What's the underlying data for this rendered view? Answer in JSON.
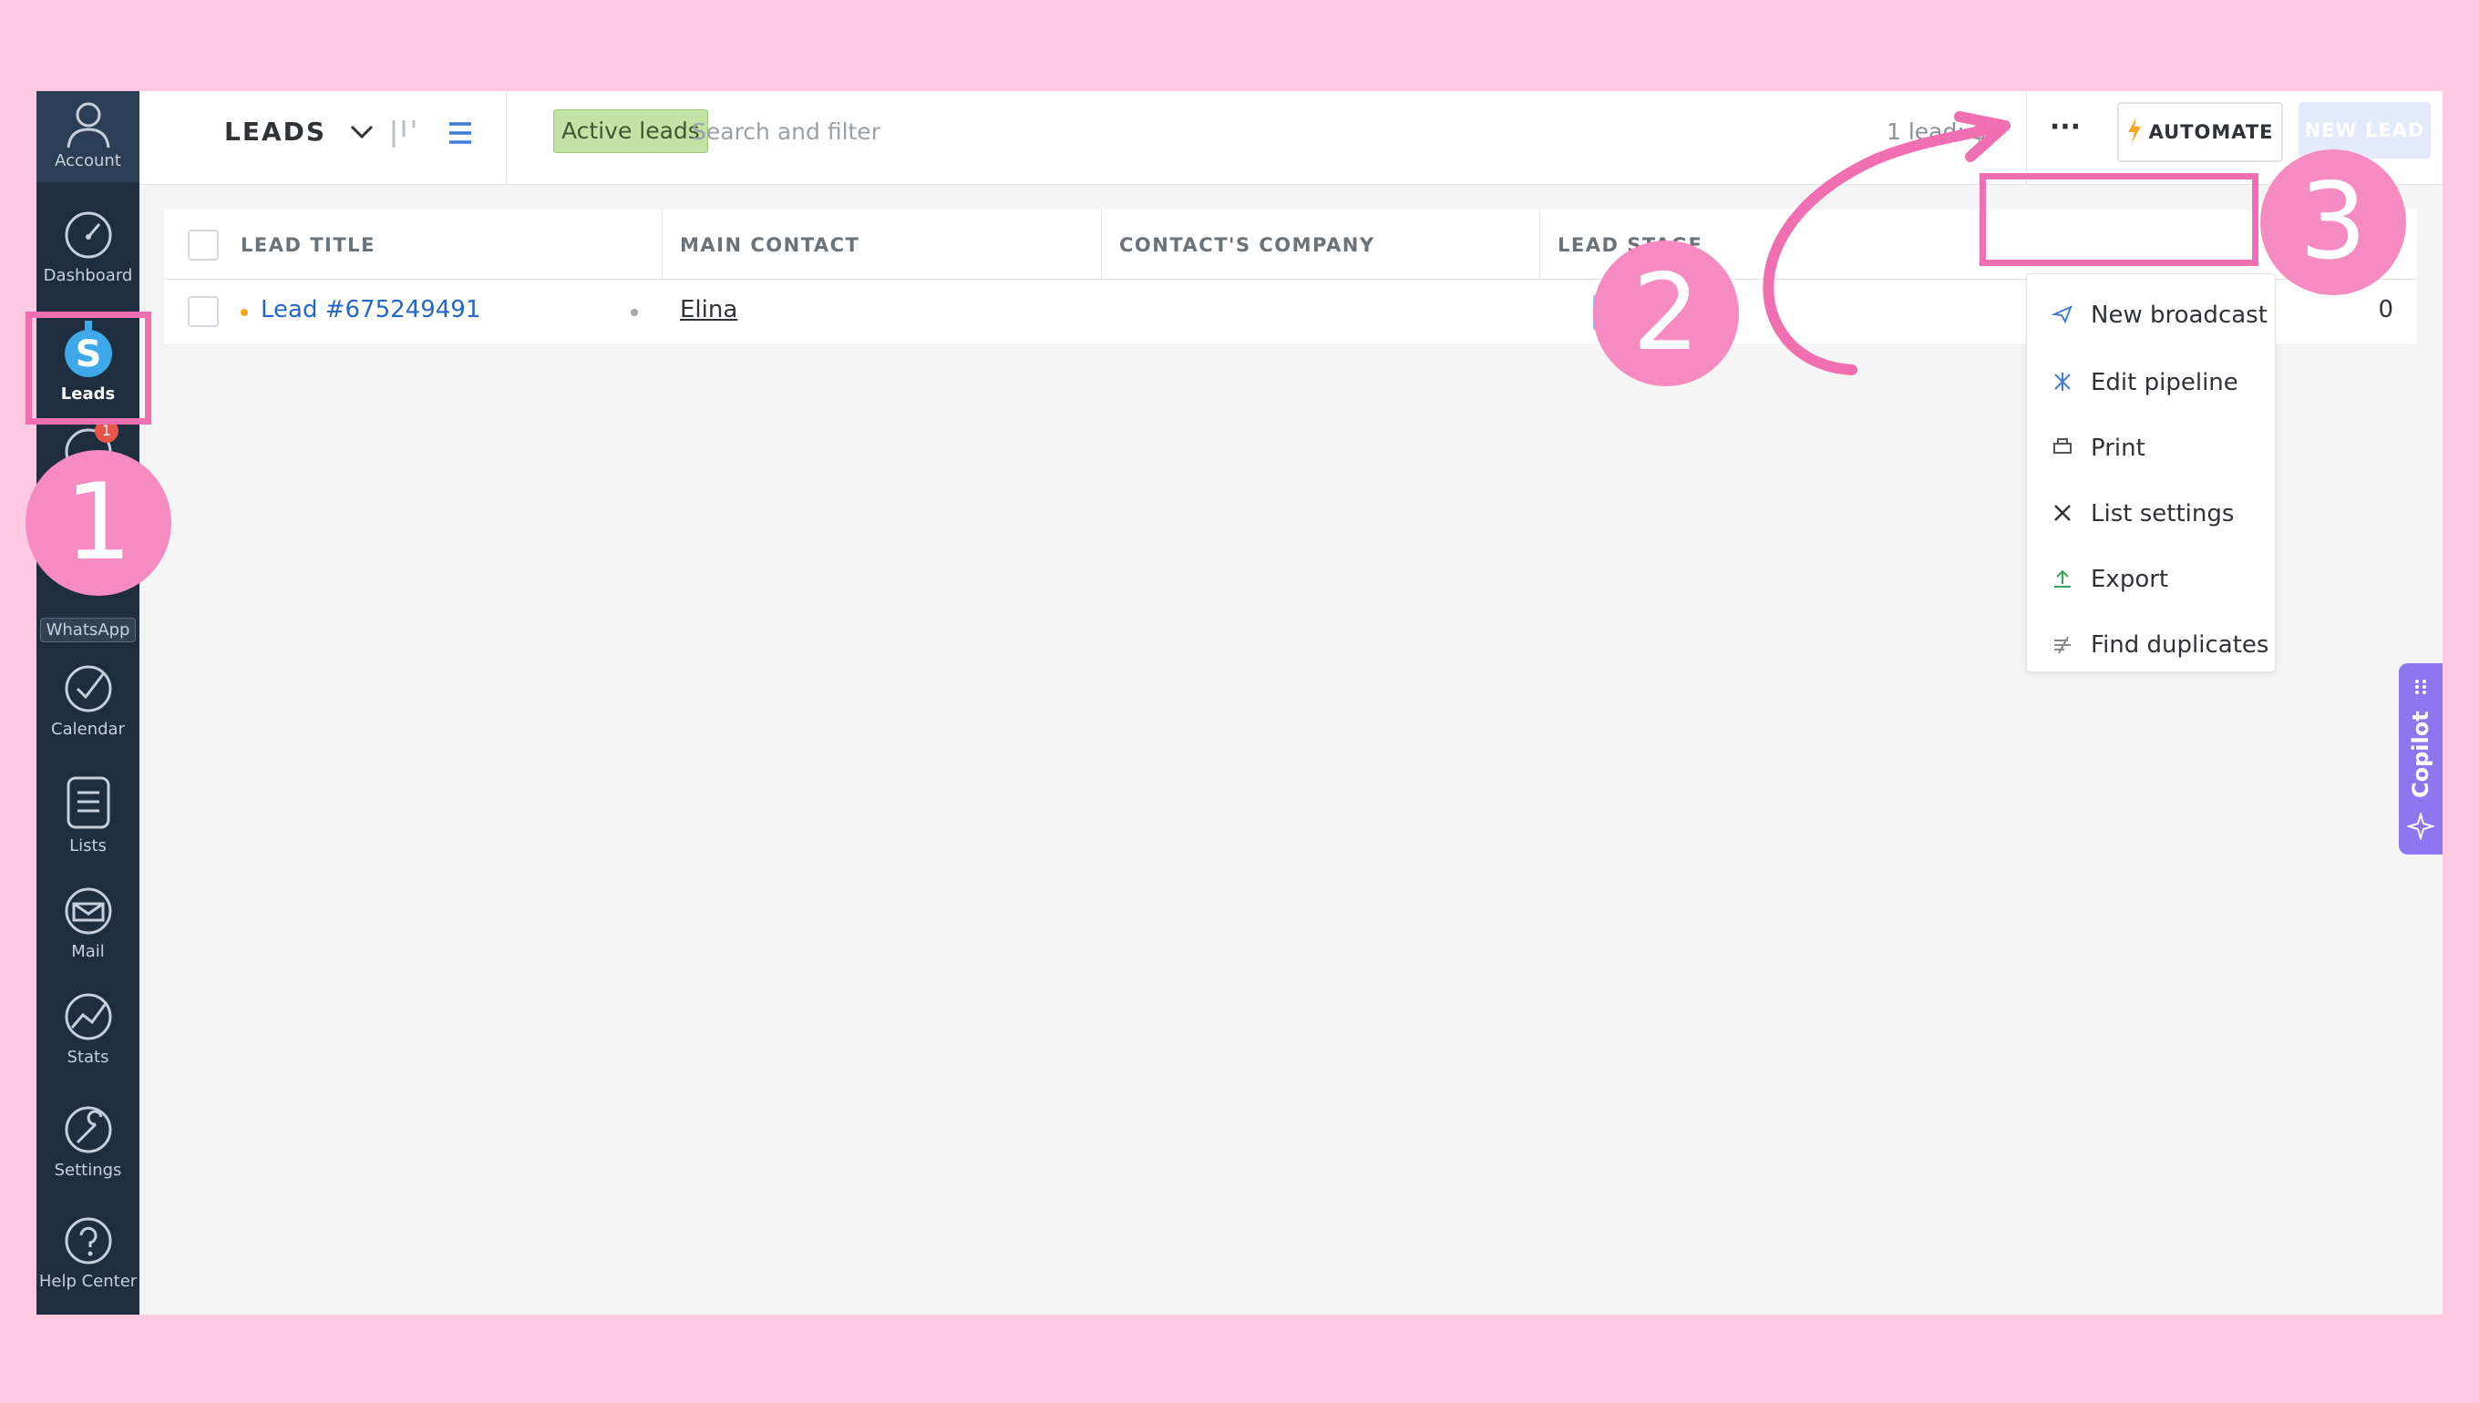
{
  "sidebar": {
    "items": [
      {
        "label": "Account",
        "icon": "account-icon"
      },
      {
        "label": "Dashboard",
        "icon": "dashboard-icon"
      },
      {
        "label": "Leads",
        "icon": "leads-icon",
        "active": true
      },
      {
        "label": "WhatsApp",
        "icon": "whatsapp-icon",
        "badge": "1"
      },
      {
        "label": "Calendar",
        "icon": "calendar-icon"
      },
      {
        "label": "Lists",
        "icon": "lists-icon"
      },
      {
        "label": "Mail",
        "icon": "mail-icon"
      },
      {
        "label": "Stats",
        "icon": "stats-icon"
      },
      {
        "label": "Settings",
        "icon": "settings-icon"
      },
      {
        "label": "Help Center",
        "icon": "help-icon"
      }
    ]
  },
  "header": {
    "title": "LEADS",
    "filter_tag": "Active leads",
    "search_placeholder": "Search and filter",
    "summary": "1 lead: $0",
    "more_label": "···",
    "automate_label": "AUTOMATE",
    "new_lead_label": "NEW LEAD"
  },
  "table": {
    "columns": [
      "LEAD TITLE",
      "MAIN CONTACT",
      "CONTACT'S COMPANY",
      "LEAD STAGE"
    ],
    "rows": [
      {
        "title": "Lead #675249491",
        "contact": "Elina",
        "company": "",
        "stage": "Ne",
        "value": "0"
      }
    ]
  },
  "menu": {
    "items": [
      {
        "label": "New broadcast",
        "icon": "broadcast-icon"
      },
      {
        "label": "Edit pipeline",
        "icon": "pipeline-icon"
      },
      {
        "label": "Print",
        "icon": "print-icon"
      },
      {
        "label": "List settings",
        "icon": "list-settings-icon"
      },
      {
        "label": "Export",
        "icon": "export-icon"
      },
      {
        "label": "Find duplicates",
        "icon": "duplicates-icon"
      }
    ]
  },
  "copilot": {
    "label": "Copilot"
  },
  "annotations": {
    "step1": "1",
    "step2": "2",
    "step3": "3"
  },
  "colors": {
    "pink": "#f58bc0",
    "accent_blue": "#3f7bd8",
    "sidebar": "#1f2e3f"
  }
}
